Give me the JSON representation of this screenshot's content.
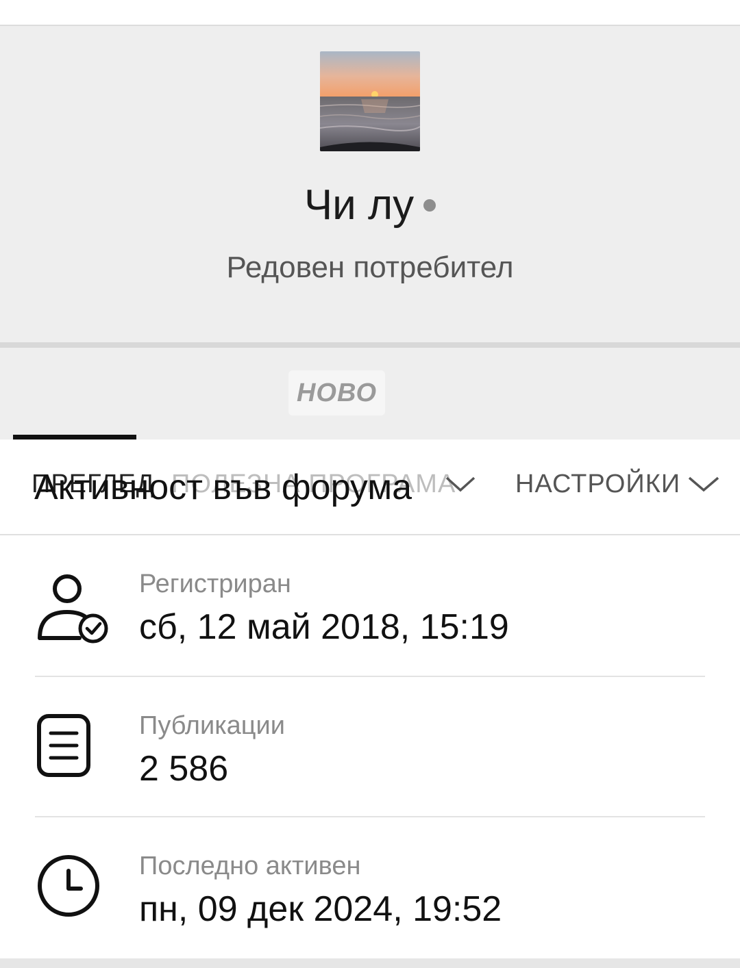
{
  "profile": {
    "username": "Чи лу",
    "rank": "Редовен потребител",
    "avatar_icon": "sunset-sea-photo"
  },
  "badge": {
    "label": "НОВО"
  },
  "tabs": [
    {
      "label": "ПРЕГЛЕД"
    },
    {
      "label": "ПОЛЕЗНА ПРОГРАМА"
    },
    {
      "label": "НАСТРОЙКИ"
    }
  ],
  "section": {
    "title": "Активност във форума"
  },
  "stats": [
    {
      "icon": "user-check-icon",
      "label": "Регистриран",
      "value": "сб, 12 май 2018, 15:19"
    },
    {
      "icon": "document-icon",
      "label": "Публикации",
      "value": "2 586"
    },
    {
      "icon": "clock-icon",
      "label": "Последно активен",
      "value": "пн, 09 дек 2024, 19:52"
    }
  ],
  "colors": {
    "accent": "#111111",
    "panel": "#eeeeee",
    "muted": "#8a8a8a"
  }
}
